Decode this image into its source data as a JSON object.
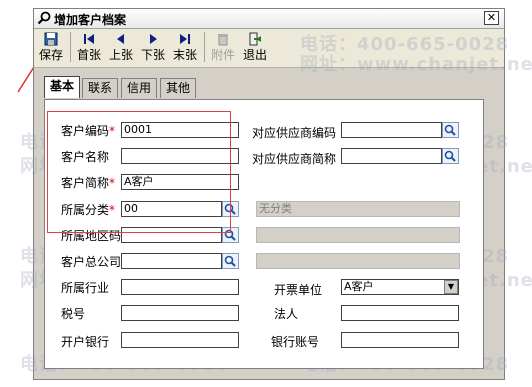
{
  "window": {
    "title": "增加客户档案",
    "close": "✕"
  },
  "toolbar": {
    "buttons": [
      {
        "label": "保存"
      },
      {
        "label": "首张"
      },
      {
        "label": "上张"
      },
      {
        "label": "下张"
      },
      {
        "label": "末张"
      },
      {
        "label": "附件"
      },
      {
        "label": "退出"
      }
    ]
  },
  "tabs": [
    {
      "label": "基本"
    },
    {
      "label": "联系"
    },
    {
      "label": "信用"
    },
    {
      "label": "其他"
    }
  ],
  "form": {
    "customer_code": {
      "label": "客户编码",
      "required": "*",
      "value": "0001"
    },
    "customer_name": {
      "label": "客户名称",
      "value": ""
    },
    "customer_abbr": {
      "label": "客户简称",
      "required": "*",
      "value": "A客户"
    },
    "category": {
      "label": "所属分类",
      "required": "*",
      "value": "00",
      "desc": "无分类"
    },
    "region": {
      "label": "所属地区码",
      "value": "",
      "desc": ""
    },
    "head_company": {
      "label": "客户总公司",
      "value": "",
      "desc": ""
    },
    "industry": {
      "label": "所属行业",
      "value": ""
    },
    "tax_no": {
      "label": "税号",
      "value": ""
    },
    "bank": {
      "label": "开户银行",
      "value": ""
    },
    "supplier_code": {
      "label": "对应供应商编码",
      "value": ""
    },
    "supplier_abbr": {
      "label": "对应供应商简称",
      "value": ""
    },
    "invoice_unit": {
      "label": "开票单位",
      "value": "A客户"
    },
    "legal_person": {
      "label": "法人",
      "value": ""
    },
    "bank_account": {
      "label": "银行账号",
      "value": ""
    }
  },
  "watermark": {
    "phone": "电话：400-665-0028",
    "site": "网址：www.chanjet.net"
  },
  "colors": {
    "annotation_red": "#e04040",
    "arrow_red": "#e03030"
  }
}
